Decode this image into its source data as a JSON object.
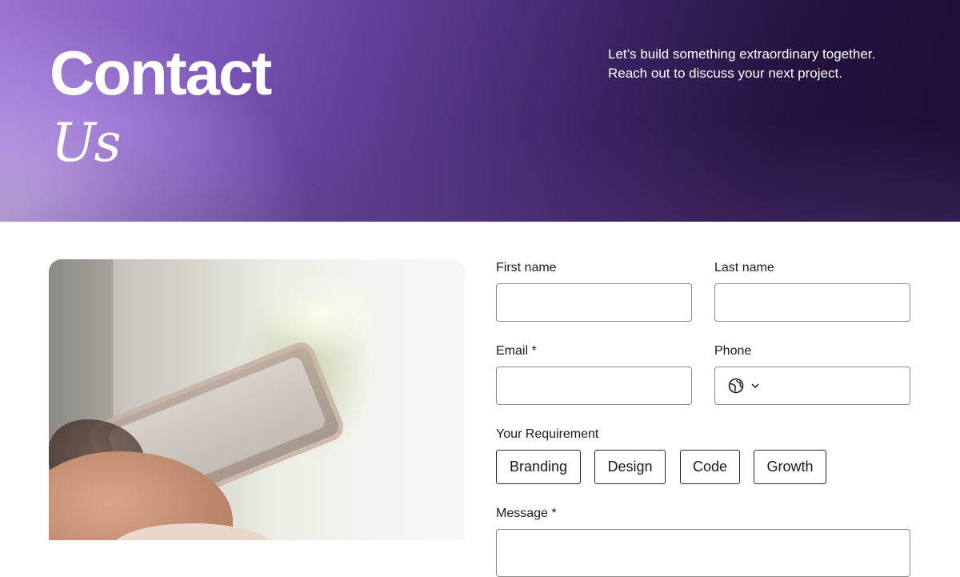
{
  "hero": {
    "title_main": "Contact",
    "title_italic": "Us",
    "tagline_line1": "Let’s build something extraordinary together.",
    "tagline_line2": "Reach out to discuss your next project."
  },
  "form": {
    "first_name_label": "First name",
    "last_name_label": "Last name",
    "email_label": "Email *",
    "phone_label": "Phone",
    "phone_country_icon": "globe-icon",
    "requirement_label": "Your Requirement",
    "requirements": [
      "Branding",
      "Design",
      "Code",
      "Growth"
    ],
    "message_label": "Message *"
  },
  "colors": {
    "hero_dark": "#1c0e33",
    "hero_mid": "#5a3a8e",
    "hero_light": "#d9c6f4"
  }
}
